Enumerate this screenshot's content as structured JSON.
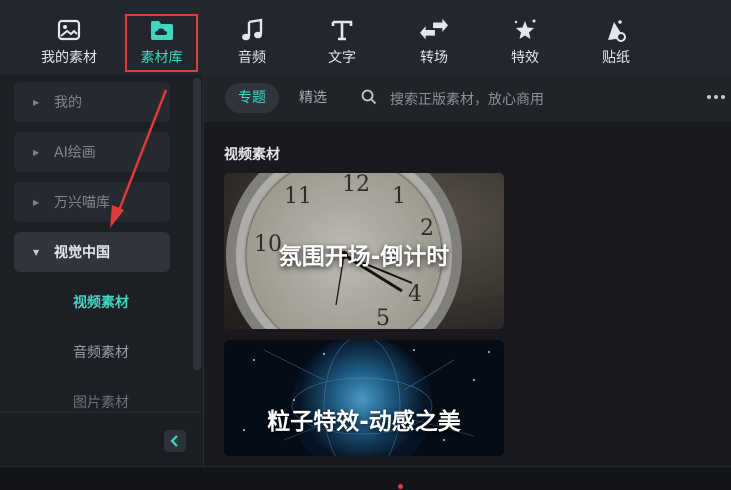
{
  "toolbar": {
    "items": [
      {
        "label": "我的素材",
        "icon": "image-icon"
      },
      {
        "label": "素材库",
        "icon": "cloud-folder-icon"
      },
      {
        "label": "音频",
        "icon": "music-note-icon"
      },
      {
        "label": "文字",
        "icon": "text-t-icon"
      },
      {
        "label": "转场",
        "icon": "transition-arrows-icon"
      },
      {
        "label": "特效",
        "icon": "sparkle-star-icon"
      },
      {
        "label": "贴纸",
        "icon": "sticker-icon"
      }
    ],
    "active_index": 1,
    "accent_color": "#3fd7c4",
    "highlight_color": "#e33b3b"
  },
  "sidebar": {
    "items": [
      {
        "label": "我的",
        "expanded": false
      },
      {
        "label": "AI绘画",
        "expanded": false
      },
      {
        "label": "万兴喵库",
        "expanded": false
      },
      {
        "label": "视觉中国",
        "expanded": true
      }
    ],
    "subitems": [
      {
        "label": "视频素材",
        "active": true
      },
      {
        "label": "音频素材",
        "active": false
      },
      {
        "label": "图片素材",
        "active": false
      }
    ],
    "collapse_icon": "chevron-left-icon"
  },
  "filterbar": {
    "tabs": [
      {
        "label": "专题",
        "active": true
      },
      {
        "label": "精选",
        "active": false
      }
    ],
    "search_placeholder": "搜索正版素材，放心商用",
    "more_icon": "more-horizontal-icon"
  },
  "content": {
    "section_title": "视频素材",
    "cards": [
      {
        "title": "氛围开场-倒计时"
      },
      {
        "title": "粒子特效-动感之美"
      }
    ]
  }
}
